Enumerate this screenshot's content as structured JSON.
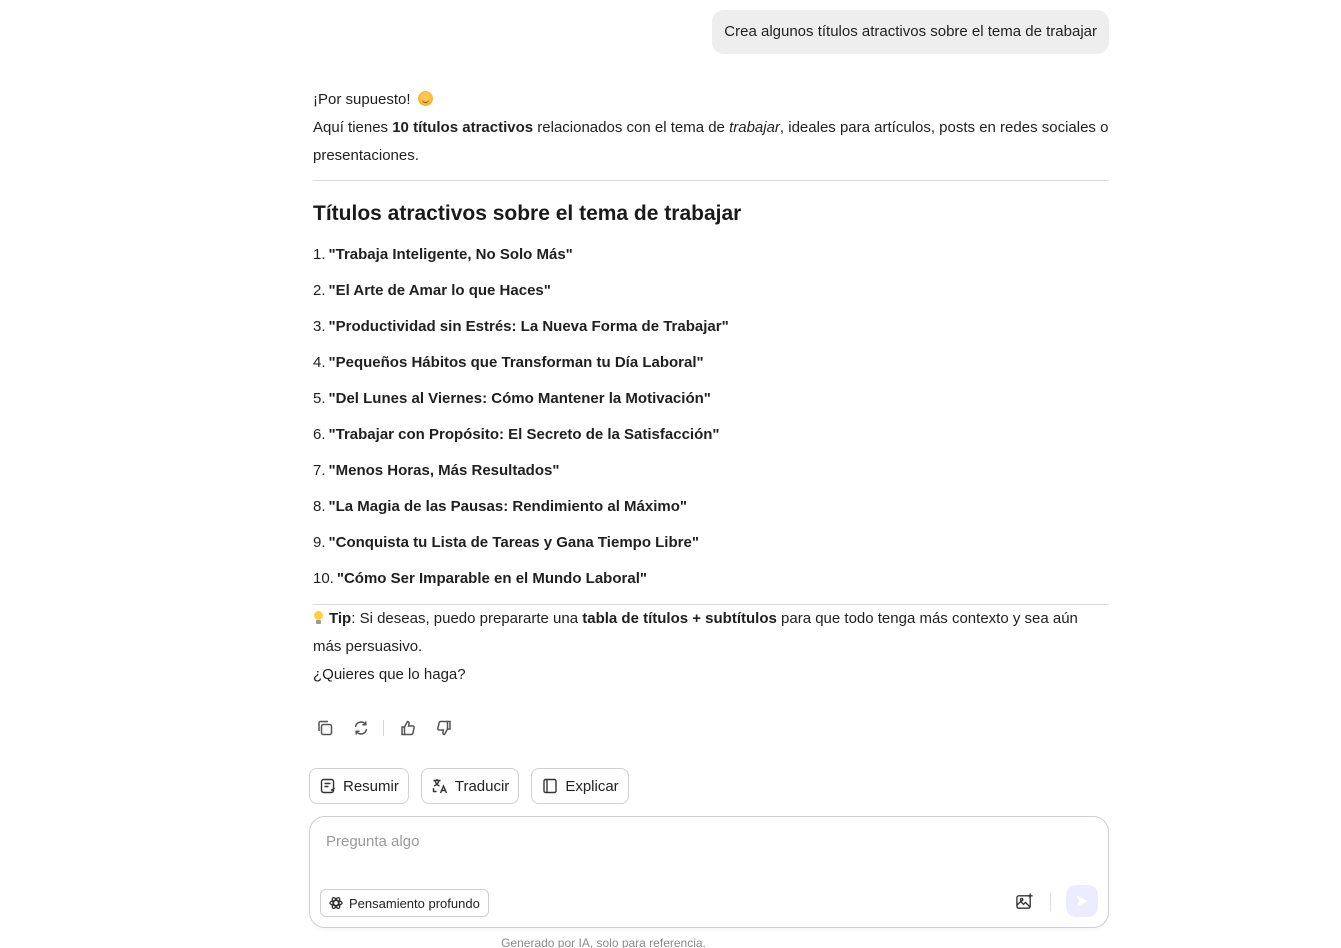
{
  "user_message": "Crea algunos títulos atractivos sobre el tema de trabajar",
  "answer": {
    "greeting": "¡Por supuesto! ",
    "intro_pre": "Aquí tienes ",
    "intro_bold": "10 títulos atractivos",
    "intro_mid": " relacionados con el tema de ",
    "intro_em": "trabajar",
    "intro_post": ", ideales para artículos, posts en redes sociales o presentaciones.",
    "heading": "Títulos atractivos sobre el tema de trabajar",
    "titles": [
      {
        "num": "1.",
        "text": "\"Trabaja Inteligente, No Solo Más\""
      },
      {
        "num": "2.",
        "text": "\"El Arte de Amar lo que Haces\""
      },
      {
        "num": "3.",
        "text": "\"Productividad sin Estrés: La Nueva Forma de Trabajar\""
      },
      {
        "num": "4.",
        "text": "\"Pequeños Hábitos que Transforman tu Día Laboral\""
      },
      {
        "num": "5.",
        "text": "\"Del Lunes al Viernes: Cómo Mantener la Motivación\""
      },
      {
        "num": "6.",
        "text": "\"Trabajar con Propósito: El Secreto de la Satisfacción\""
      },
      {
        "num": "7.",
        "text": "\"Menos Horas, Más Resultados\""
      },
      {
        "num": "8.",
        "text": "\"La Magia de las Pausas: Rendimiento al Máximo\""
      },
      {
        "num": "9.",
        "text": "\"Conquista tu Lista de Tareas y Gana Tiempo Libre\""
      },
      {
        "num": "10.",
        "text": "\"Cómo Ser Imparable en el Mundo Laboral\""
      }
    ],
    "tip_label": "Tip",
    "tip_pre": ": Si deseas, puedo prepararte una ",
    "tip_bold": "tabla de títulos + subtítulos",
    "tip_post": " para que todo tenga más contexto y sea aún más persuasivo.",
    "question": "¿Quieres que lo haga?"
  },
  "message_actions": {
    "copy_icon": "copy-icon",
    "regenerate_icon": "refresh-icon",
    "like_icon": "thumbs-up-icon",
    "dislike_icon": "thumbs-down-icon"
  },
  "quick_actions": [
    {
      "label": "Resumir",
      "icon": "summarize-icon"
    },
    {
      "label": "Traducir",
      "icon": "translate-icon"
    },
    {
      "label": "Explicar",
      "icon": "book-icon"
    }
  ],
  "composer": {
    "placeholder": "Pregunta algo",
    "value": "",
    "deep_thinking_label": "Pensamiento profundo",
    "send_color": "#ecebff"
  },
  "disclaimer": "Generado por IA, solo para referencia."
}
